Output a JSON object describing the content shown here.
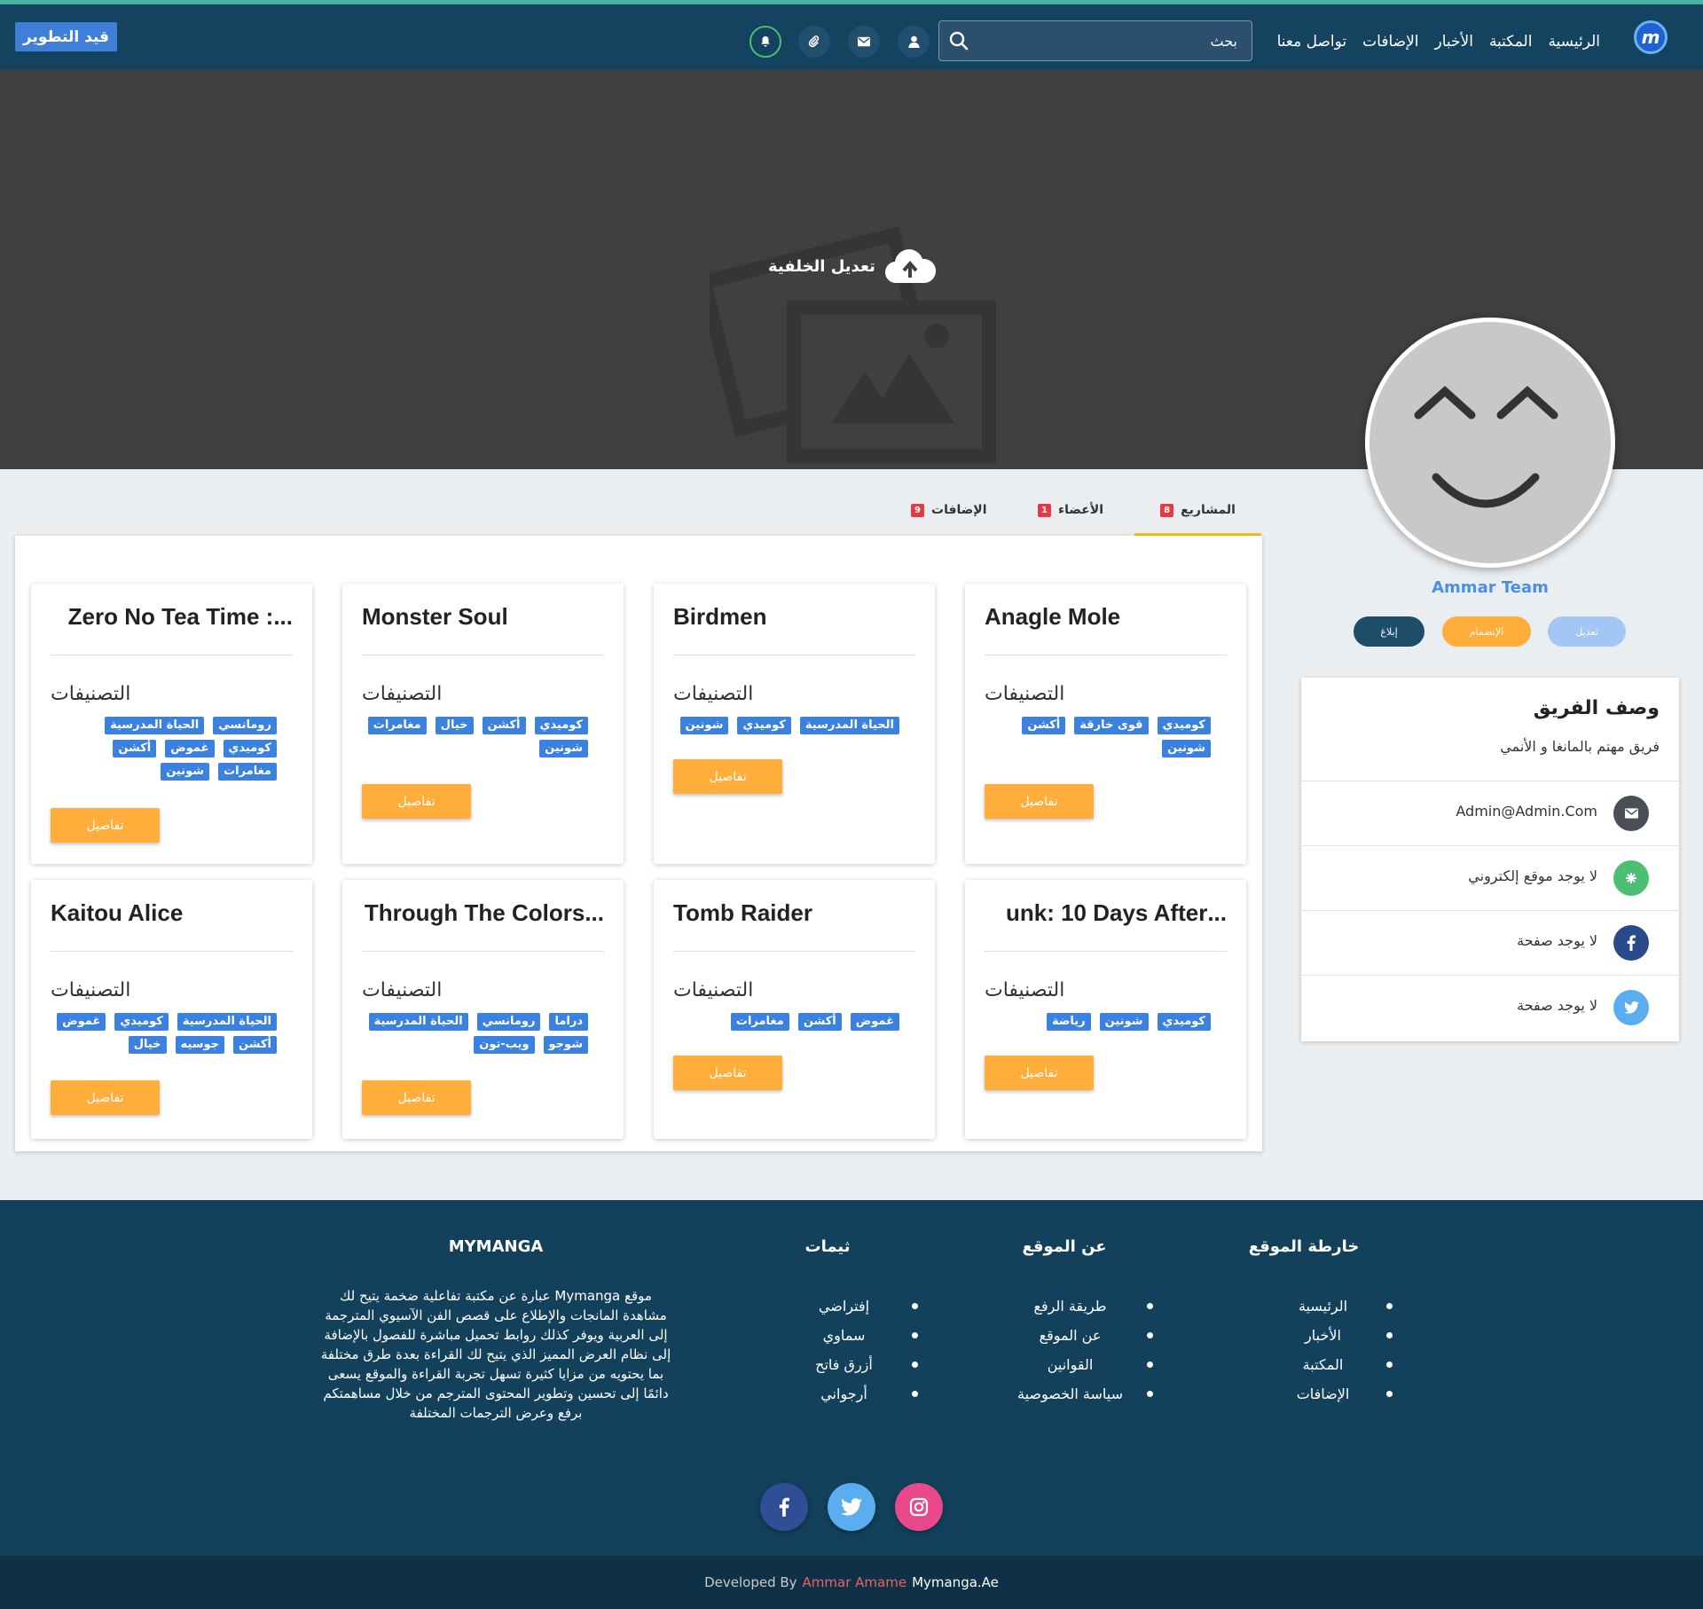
{
  "nav": {
    "dev_badge": "قيد التطوير",
    "logo_letter": "m",
    "links": [
      "الرئيسية",
      "المكتبة",
      "الأخبار",
      "الإضافات",
      "تواصل معنا"
    ],
    "search_placeholder": "بحث",
    "icons": [
      "user-icon",
      "envelope-icon",
      "paperclip-icon",
      "bell-icon"
    ]
  },
  "cover": {
    "edit_label": "تعديل الخلفية"
  },
  "profile": {
    "team_name": "Ammar Team",
    "buttons": {
      "edit": "تعديل",
      "join": "الإنضمام",
      "report": "إبلاغ"
    }
  },
  "sidebar": {
    "title": "وصف الفريق",
    "description": "فريق مهتم بالمانغا و الأنمي",
    "rows": [
      {
        "icon": "envelope-icon",
        "text": "Admin@Admin.Com",
        "color": "#4a4f57"
      },
      {
        "icon": "globe-icon",
        "text": "لا يوجد موقع إلكتروني",
        "color": "#4bbf73"
      },
      {
        "icon": "facebook-icon",
        "text": "لا يوجد صفحة",
        "color": "#2b4a8b"
      },
      {
        "icon": "twitter-icon",
        "text": "لا يوجد صفحة",
        "color": "#5aaef0"
      }
    ]
  },
  "tabs": [
    {
      "label": "المشاريع",
      "count": "8",
      "active": true
    },
    {
      "label": "الأعضاء",
      "count": "1",
      "active": false
    },
    {
      "label": "الإضافات",
      "count": "9",
      "active": false
    }
  ],
  "projects": {
    "categories_label": "التصنيفات",
    "details_label": "تفاصيل",
    "items": [
      {
        "title": "Anagle Mole",
        "tags": [
          "كوميدي",
          "قوى خارقة",
          "أكشن",
          "شونين"
        ]
      },
      {
        "title": "Birdmen",
        "tags": [
          "الحياة المدرسية",
          "كوميدي",
          "شونين"
        ]
      },
      {
        "title": "Monster Soul",
        "tags": [
          "كوميدي",
          "أكشن",
          "خيال",
          "مغامرات",
          "شونين"
        ]
      },
      {
        "title": "...: Zero No Tea Time",
        "tags": [
          "رومانسي",
          "الحياة المدرسية",
          "كوميدي",
          "غموض",
          "أكشن",
          "مغامرات",
          "شونين"
        ]
      },
      {
        "title": "...unk: 10 Days After",
        "tags": [
          "كوميدي",
          "شونين",
          "رياضة"
        ]
      },
      {
        "title": "Tomb Raider",
        "tags": [
          "غموض",
          "أكشن",
          "مغامرات"
        ]
      },
      {
        "title": "...Through The Colors",
        "tags": [
          "دراما",
          "رومانسي",
          "الحياة المدرسية",
          "شوجو",
          "ويب-تون"
        ]
      },
      {
        "title": "Kaitou Alice",
        "tags": [
          "الحياة المدرسية",
          "كوميدي",
          "غموض",
          "أكشن",
          "جوسيه",
          "خيال"
        ]
      }
    ]
  },
  "footer": {
    "sitemap": {
      "title": "خارطة الموقع",
      "items": [
        "الرئيسية",
        "الأخبار",
        "المكتبة",
        "الإضافات"
      ]
    },
    "about_site": {
      "title": "عن الموقع",
      "items": [
        "طريقة الرفع",
        "عن الموقع",
        "القوانين",
        "سياسة الخصوصية"
      ]
    },
    "themes": {
      "title": "ثيمات",
      "items": [
        "إفتراضي",
        "سماوي",
        "أزرق فاتح",
        "أرجواني"
      ]
    },
    "about": {
      "title": "MYMANGA",
      "text": "موقع Mymanga عبارة عن مكتبة تفاعلية ضخمة يتيح لك مشاهدة المانجات والإطلاع على قصص الفن الآسيوي المترجمة إلى العربية ويوفر كذلك روابط تحميل مباشرة للفصول بالإضافة إلى نظام العرض المميز الذي يتيح لك القراءة بعدة طرق مختلفة بما يحتويه من مزايا كثيرة تسهل تجربة القراءة والموقع يسعى دائمًا إلى تحسين وتطوير المحتوى المترجم من خلال مساهمتكم برفع وعرض الترجمات المختلفة"
    },
    "social": [
      {
        "icon": "facebook-icon",
        "color": "#2f4e96"
      },
      {
        "icon": "twitter-icon",
        "color": "#5aaef0"
      },
      {
        "icon": "instagram-icon",
        "color": "#e9488a"
      }
    ],
    "credit": {
      "prefix": "Developed By",
      "author": "Ammar Amame",
      "site": "Mymanga.Ae"
    }
  }
}
